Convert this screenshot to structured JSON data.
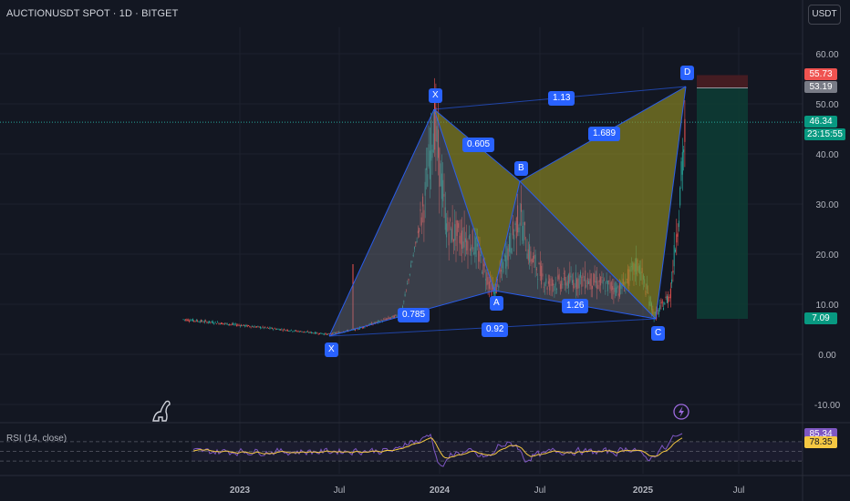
{
  "header": {
    "symbol_title": "AUCTIONUSDT SPOT · 1D · BITGET",
    "currency_button": "USDT"
  },
  "price_axis": {
    "ticks": [
      "60.00",
      "50.00",
      "40.00",
      "30.00",
      "20.00",
      "10.00",
      "0.00",
      "-10.00"
    ]
  },
  "price_tags": {
    "stop": "55.73",
    "entry": "53.19",
    "last_price": "46.34",
    "countdown": "23:15:55",
    "target": "7.09"
  },
  "time_axis": {
    "labels": [
      "2023",
      "Jul",
      "2024",
      "Jul",
      "2025",
      "Jul"
    ]
  },
  "harmonic_pattern": {
    "points": [
      "X",
      "X",
      "A",
      "B",
      "C",
      "D"
    ],
    "ratios": [
      "1.13",
      "0.605",
      "1.689",
      "0.785",
      "1.26",
      "0.92"
    ]
  },
  "rsi": {
    "label": "RSI (14, close)",
    "value": "85.34",
    "ma_value": "78.35"
  },
  "icons": {
    "logo": "tradingview-logo-icon",
    "alert": "lightning-icon"
  },
  "colors": {
    "background": "#131722",
    "pattern_blue": "#2962ff",
    "pattern_fill_gray": "#6b6f7a",
    "pattern_fill_olive": "#8f8a24",
    "candle_up": "#26a69a",
    "candle_down": "#ef5350",
    "rsi_line": "#7e57c2",
    "rsi_ma": "#f5c842",
    "profit_zone": "#0d3b34",
    "loss_zone": "#4a1d22"
  },
  "chart_data": {
    "type": "candlestick",
    "symbol": "AUCTIONUSDT",
    "interval": "1D",
    "exchange": "BITGET",
    "x_axis": [
      "2023",
      "Jul",
      "2024",
      "Jul",
      "2025",
      "Jul"
    ],
    "y_range": [
      -10,
      60
    ],
    "harmonic_points": [
      {
        "label": "X",
        "price": 4.0
      },
      {
        "label": "X",
        "price": 47.5
      },
      {
        "label": "A",
        "price": 12.5
      },
      {
        "label": "B",
        "price": 34.5
      },
      {
        "label": "C",
        "price": 7.5
      },
      {
        "label": "D",
        "price": 53.0
      }
    ],
    "trade_box": {
      "entry": 53.19,
      "stop": 55.73,
      "target": 7.09
    },
    "last_price": 46.34,
    "rsi": {
      "period": 14,
      "source": "close",
      "value": 85.34,
      "ma": 78.35,
      "bands": [
        70,
        30
      ]
    }
  }
}
